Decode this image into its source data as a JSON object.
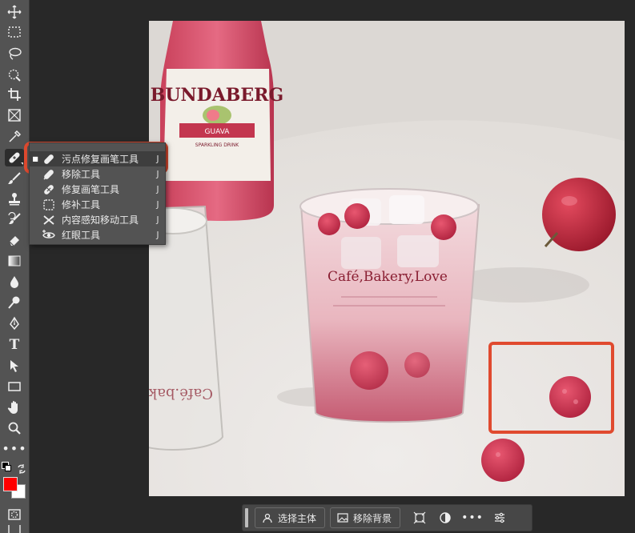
{
  "toolbar": {
    "tools": [
      {
        "name": "move-tool",
        "icon": "move-icon"
      },
      {
        "name": "marquee-tool",
        "icon": "marquee-icon"
      },
      {
        "name": "lasso-tool",
        "icon": "lasso-icon"
      },
      {
        "name": "quick-selection-tool",
        "icon": "quick-selection-icon"
      },
      {
        "name": "crop-tool",
        "icon": "crop-icon"
      },
      {
        "name": "frame-tool",
        "icon": "frame-icon"
      },
      {
        "name": "eyedropper-tool",
        "icon": "eyedropper-icon"
      },
      {
        "name": "spot-healing-brush-tool",
        "icon": "bandage-icon",
        "active": true
      },
      {
        "name": "brush-tool",
        "icon": "brush-icon"
      },
      {
        "name": "clone-stamp-tool",
        "icon": "stamp-icon"
      },
      {
        "name": "history-brush-tool",
        "icon": "history-brush-icon"
      },
      {
        "name": "eraser-tool",
        "icon": "eraser-icon"
      },
      {
        "name": "gradient-tool",
        "icon": "gradient-icon"
      },
      {
        "name": "blur-tool",
        "icon": "blur-drop-icon"
      },
      {
        "name": "dodge-tool",
        "icon": "dodge-icon"
      },
      {
        "name": "pen-tool",
        "icon": "pen-icon"
      },
      {
        "name": "type-tool",
        "icon": "type-icon"
      },
      {
        "name": "path-selection-tool",
        "icon": "arrow-select-icon"
      },
      {
        "name": "rectangle-tool",
        "icon": "rectangle-icon"
      },
      {
        "name": "hand-tool",
        "icon": "hand-icon"
      },
      {
        "name": "zoom-tool",
        "icon": "zoom-icon"
      },
      {
        "name": "edit-toolbar",
        "icon": "more-dots-icon"
      }
    ],
    "type_glyph": "T",
    "more_glyph": "•••",
    "foreground_color": "#ff0000",
    "background_color": "#ffffff"
  },
  "flyout": {
    "items": [
      {
        "label": "污点修复画笔工具",
        "key": "J",
        "icon": "bandage-icon",
        "selected": true,
        "mark": "■"
      },
      {
        "label": "移除工具",
        "key": "J",
        "icon": "remove-tool-icon"
      },
      {
        "label": "修复画笔工具",
        "key": "J",
        "icon": "healing-brush-icon"
      },
      {
        "label": "修补工具",
        "key": "J",
        "icon": "patch-icon"
      },
      {
        "label": "内容感知移动工具",
        "key": "J",
        "icon": "content-aware-move-icon"
      },
      {
        "label": "红眼工具",
        "key": "J",
        "icon": "red-eye-icon"
      }
    ]
  },
  "photo": {
    "bottle_brand": "BUNDABERG",
    "bottle_flavor": "GUAVA",
    "bottle_sub": "SPARKLING DRINK",
    "glass_text": "Café,Bakery,Love",
    "back_glass_text": "Café.bakery",
    "highlight_color": "#e04a2f"
  },
  "taskbar": {
    "select_subject": "选择主体",
    "remove_background": "移除背景",
    "more_glyph": "•••"
  }
}
